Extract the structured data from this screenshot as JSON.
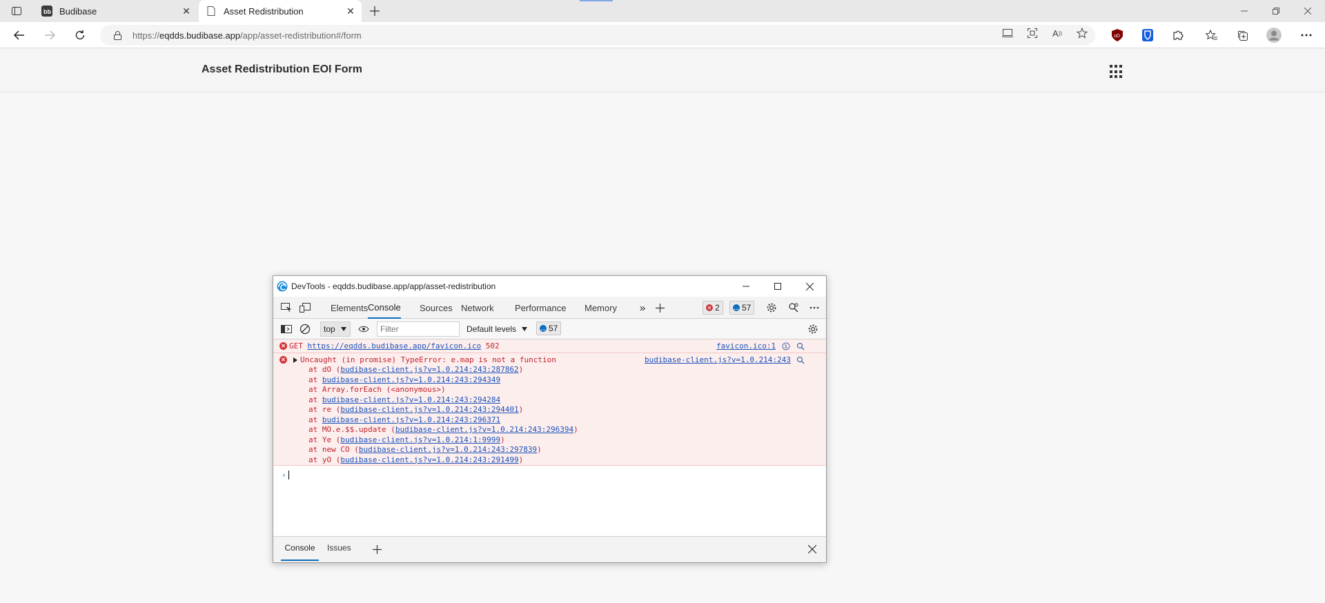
{
  "browser": {
    "tabs": [
      {
        "title": "Budibase",
        "active": false
      },
      {
        "title": "Asset Redistribution",
        "active": true
      }
    ],
    "url_prefix": "https://",
    "url_host": "eqdds.budibase.app",
    "url_path": "/app/asset-redistribution#/form",
    "read_aloud_label": "A",
    "ublock_label": "uD"
  },
  "page": {
    "title": "Asset Redistribution EOI Form"
  },
  "devtools": {
    "window_title": "DevTools - eqdds.budibase.app/app/asset-redistribution",
    "tabs": [
      "Elements",
      "Console",
      "Sources",
      "Network",
      "Performance",
      "Memory"
    ],
    "selected_tab": "Console",
    "error_count": "2",
    "message_count": "57",
    "context": "top",
    "filter_placeholder": "Filter",
    "levels_label": "Default levels",
    "filter_message_count": "57",
    "messages": [
      {
        "method": "GET",
        "url": "https://eqdds.budibase.app/favicon.ico",
        "status": "502",
        "source": "favicon.ico:1"
      },
      {
        "text": "Uncaught (in promise) TypeError: e.map is not a function",
        "source": "budibase-client.js?v=1.0.214:243",
        "stack": [
          {
            "prefix": "at dO (",
            "link": "budibase-client.js?v=1.0.214:243:287862",
            "suffix": ")"
          },
          {
            "prefix": "at ",
            "link": "budibase-client.js?v=1.0.214:243:294349",
            "suffix": ""
          },
          {
            "prefix": "at Array.forEach (<anonymous>)",
            "link": "",
            "suffix": ""
          },
          {
            "prefix": "at ",
            "link": "budibase-client.js?v=1.0.214:243:294284",
            "suffix": ""
          },
          {
            "prefix": "at re (",
            "link": "budibase-client.js?v=1.0.214:243:294401",
            "suffix": ")"
          },
          {
            "prefix": "at ",
            "link": "budibase-client.js?v=1.0.214:243:296371",
            "suffix": ""
          },
          {
            "prefix": "at MO.e.$$.update (",
            "link": "budibase-client.js?v=1.0.214:243:296394",
            "suffix": ")"
          },
          {
            "prefix": "at Ye (",
            "link": "budibase-client.js?v=1.0.214:1:9999",
            "suffix": ")"
          },
          {
            "prefix": "at new CO (",
            "link": "budibase-client.js?v=1.0.214:243:297839",
            "suffix": ")"
          },
          {
            "prefix": "at yO (",
            "link": "budibase-client.js?v=1.0.214:243:291499",
            "suffix": ")"
          }
        ]
      }
    ],
    "drawer_tabs": [
      "Console",
      "Issues"
    ]
  },
  "colors": {
    "error": "#c0232b",
    "error_bg": "#fdeeee",
    "link": "#1a52b8",
    "accent": "#0f6cbd"
  }
}
